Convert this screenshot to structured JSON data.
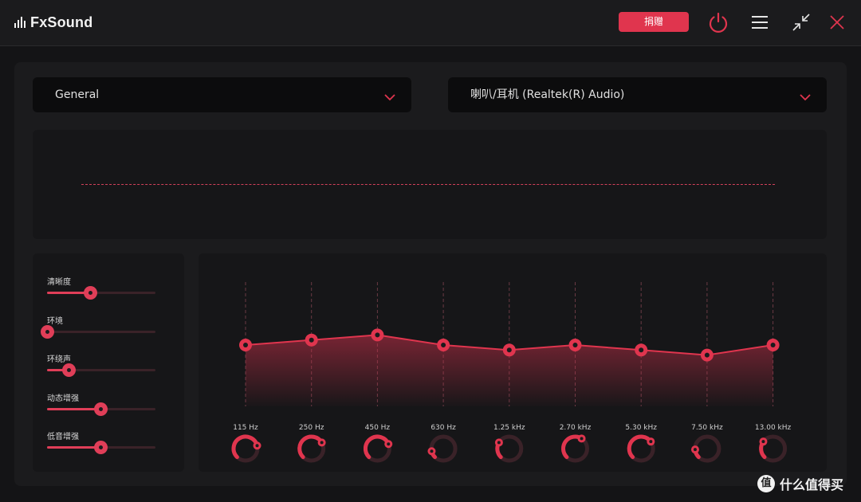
{
  "app": {
    "name": "FxSound",
    "donate_label": "捐赠",
    "accent": "#e0354e"
  },
  "titlebar_icons": [
    "power-icon",
    "menu-icon",
    "collapse-icon",
    "close-icon"
  ],
  "preset": {
    "selected": "General"
  },
  "output_device": {
    "selected": "喇叭/耳机 (Realtek(R) Audio)"
  },
  "effects": [
    {
      "label": "清晰度",
      "value": 0.4
    },
    {
      "label": "环境",
      "value": 0.0
    },
    {
      "label": "环绕声",
      "value": 0.2
    },
    {
      "label": "动态增强",
      "value": 0.49
    },
    {
      "label": "低音增强",
      "value": 0.49
    }
  ],
  "equalizer": {
    "bands": [
      {
        "freq": "115 Hz",
        "gain": 0.0,
        "knob": 0.78
      },
      {
        "freq": "250 Hz",
        "gain": 0.6,
        "knob": 0.72
      },
      {
        "freq": "450 Hz",
        "gain": 1.2,
        "knob": 0.75
      },
      {
        "freq": "630 Hz",
        "gain": 0.0,
        "knob": 0.12
      },
      {
        "freq": "1.25 kHz",
        "gain": -0.6,
        "knob": 0.28
      },
      {
        "freq": "2.70 kHz",
        "gain": 0.0,
        "knob": 0.62
      },
      {
        "freq": "5.30 kHz",
        "gain": -0.6,
        "knob": 0.7
      },
      {
        "freq": "7.50 kHz",
        "gain": -1.2,
        "knob": 0.15
      },
      {
        "freq": "13.00 kHz",
        "gain": 0.0,
        "knob": 0.3
      }
    ]
  },
  "watermark": {
    "badge": "值",
    "text": "什么值得买"
  }
}
